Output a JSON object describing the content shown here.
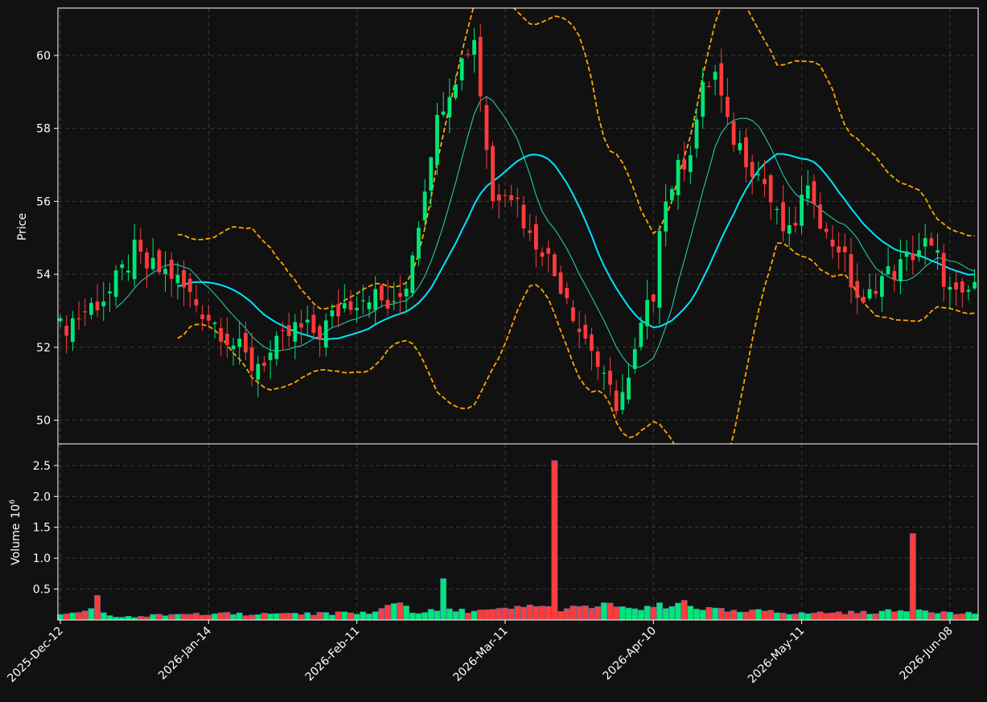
{
  "chart_data": {
    "type": "candlestick",
    "style": {
      "background": "#111111",
      "up_color": "#00e676",
      "down_color": "#ff3b3b",
      "ma_slow_color": "#00e5ff",
      "ma_fast_color": "#26c6b0",
      "band_color": "#ffa500",
      "grid": true
    },
    "price_panel": {
      "ylabel": "Price",
      "ylim": [
        49.35,
        61.3
      ],
      "yticks": [
        50,
        52,
        54,
        56,
        58,
        60
      ]
    },
    "volume_panel": {
      "ylabel": "Volume",
      "exponent_label": "10^6",
      "ylim": [
        0,
        2.85
      ],
      "yticks": [
        0.5,
        1.0,
        1.5,
        2.0,
        2.5
      ],
      "ytick_labels": [
        "0.5",
        "1.0",
        "1.5",
        "2.0",
        "2.5"
      ]
    },
    "x_ticks": [
      {
        "index": 0,
        "label": "2025-Dec-12"
      },
      {
        "index": 24,
        "label": "2026-Jan-14"
      },
      {
        "index": 48,
        "label": "2026-Feb-11"
      },
      {
        "index": 72,
        "label": "2026-Mar-11"
      },
      {
        "index": 96,
        "label": "2026-Apr-10"
      },
      {
        "index": 120,
        "label": "2026-May-11"
      },
      {
        "index": 144,
        "label": "2026-Jun-08"
      }
    ],
    "n_bars": 149,
    "anchors": {
      "close": [
        [
          0,
          52.5
        ],
        [
          8,
          53.5
        ],
        [
          12,
          54.6
        ],
        [
          14,
          54.2
        ],
        [
          18,
          54.0
        ],
        [
          22,
          53.2
        ],
        [
          26,
          52.5
        ],
        [
          31,
          51.5
        ],
        [
          34,
          51.8
        ],
        [
          38,
          52.5
        ],
        [
          42,
          52.4
        ],
        [
          46,
          53.2
        ],
        [
          50,
          53.5
        ],
        [
          54,
          53.0
        ],
        [
          56,
          53.8
        ],
        [
          58,
          55.5
        ],
        [
          60,
          57.5
        ],
        [
          62,
          58.8
        ],
        [
          64,
          59.5
        ],
        [
          66,
          60.2
        ],
        [
          67,
          60.5
        ],
        [
          68,
          59.0
        ],
        [
          70,
          56.0
        ],
        [
          72,
          56.5
        ],
        [
          74,
          56.0
        ],
        [
          76,
          55.0
        ],
        [
          78,
          54.8
        ],
        [
          80,
          54.0
        ],
        [
          82,
          53.5
        ],
        [
          84,
          52.5
        ],
        [
          86,
          52.0
        ],
        [
          88,
          51.0
        ],
        [
          90,
          50.5
        ],
        [
          92,
          51.0
        ],
        [
          94,
          52.5
        ],
        [
          96,
          53.5
        ],
        [
          97,
          55.5
        ],
        [
          99,
          56.5
        ],
        [
          102,
          57.5
        ],
        [
          104,
          59.0
        ],
        [
          106,
          59.5
        ],
        [
          108,
          58.0
        ],
        [
          110,
          57.5
        ],
        [
          112,
          57.0
        ],
        [
          114,
          56.5
        ],
        [
          116,
          55.5
        ],
        [
          118,
          55.0
        ],
        [
          120,
          56.0
        ],
        [
          122,
          56.2
        ],
        [
          124,
          55.0
        ],
        [
          126,
          54.8
        ],
        [
          128,
          53.8
        ],
        [
          130,
          53.0
        ],
        [
          132,
          53.8
        ],
        [
          134,
          54.0
        ],
        [
          136,
          54.2
        ],
        [
          138,
          54.6
        ],
        [
          140,
          54.8
        ],
        [
          142,
          54.4
        ],
        [
          144,
          53.5
        ],
        [
          146,
          53.2
        ],
        [
          148,
          53.8
        ],
        [
          149,
          55.0
        ]
      ],
      "volume": [
        [
          0,
          0.08
        ],
        [
          4,
          0.14
        ],
        [
          6,
          0.35
        ],
        [
          7,
          0.1
        ],
        [
          9,
          0.05
        ],
        [
          13,
          0.06
        ],
        [
          18,
          0.1
        ],
        [
          24,
          0.1
        ],
        [
          30,
          0.1
        ],
        [
          40,
          0.1
        ],
        [
          47,
          0.12
        ],
        [
          51,
          0.12
        ],
        [
          55,
          0.32
        ],
        [
          57,
          0.12
        ],
        [
          61,
          0.15
        ],
        [
          62,
          0.67
        ],
        [
          63,
          0.15
        ],
        [
          70,
          0.15
        ],
        [
          75,
          0.2
        ],
        [
          77,
          0.25
        ],
        [
          79,
          0.2
        ],
        [
          80,
          2.58
        ],
        [
          81,
          0.18
        ],
        [
          85,
          0.2
        ],
        [
          90,
          0.25
        ],
        [
          93,
          0.15
        ],
        [
          96,
          0.2
        ],
        [
          97,
          0.31
        ],
        [
          98,
          0.15
        ],
        [
          101,
          0.32
        ],
        [
          103,
          0.2
        ],
        [
          110,
          0.12
        ],
        [
          115,
          0.16
        ],
        [
          119,
          0.1
        ],
        [
          124,
          0.12
        ],
        [
          130,
          0.12
        ],
        [
          137,
          0.15
        ],
        [
          138,
          1.4
        ],
        [
          139,
          0.18
        ],
        [
          145,
          0.1
        ],
        [
          149,
          0.12
        ]
      ]
    },
    "volume_overrides": [
      [
        12,
        0.04
      ],
      [
        13,
        0.06
      ],
      [
        14,
        0.05
      ],
      [
        17,
        0.07
      ],
      [
        18,
        0.09
      ],
      [
        24,
        0.08
      ],
      [
        25,
        0.1
      ],
      [
        28,
        0.09
      ],
      [
        30,
        0.07
      ],
      [
        34,
        0.1
      ],
      [
        44,
        0.08
      ],
      [
        50,
        0.1
      ]
    ],
    "series": [
      {
        "name": "",
        "kind": "candles"
      },
      {
        "name": "",
        "kind": "ma_slow",
        "window": 20
      },
      {
        "name": "",
        "kind": "ma_fast",
        "window": 10
      },
      {
        "name": "",
        "kind": "upper_band",
        "mult": 2
      },
      {
        "name": "",
        "kind": "lower_band",
        "mult": 2
      }
    ]
  }
}
